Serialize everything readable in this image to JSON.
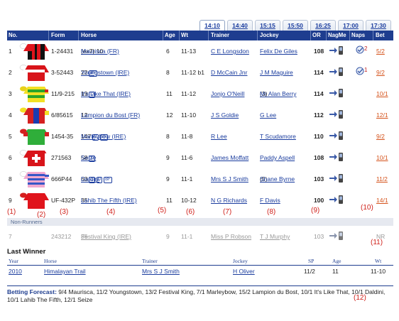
{
  "tabs": [
    "14:10",
    "14:40",
    "15:15",
    "15:50",
    "16:25",
    "17:00",
    "17:30"
  ],
  "active_tab": "14:10",
  "columns": {
    "no": "No.",
    "form": "Form",
    "horse": "Horse",
    "age": "Age",
    "wt": "Wt",
    "trainer": "Trainer",
    "jockey": "Jockey",
    "or": "OR",
    "nagme": "NagMe",
    "naps": "Naps",
    "bet": "Bet"
  },
  "runners": [
    {
      "no": "1",
      "form": "1-24431",
      "horse": "Maurisca (FR)",
      "horse_extra": "(ex7) 10",
      "badges": [],
      "age": "6",
      "wt": "11-13",
      "trainer": "C E Longsdon",
      "jockey": "Felix De Giles",
      "jockey_extra": "",
      "or": "108",
      "naps": "2",
      "bet": "5/2"
    },
    {
      "no": "2",
      "form": "3-52443",
      "horse": "Youngstown (IRE)",
      "horse_extra": "22",
      "badges": [
        "BF"
      ],
      "age": "8",
      "wt": "11-12 b1",
      "trainer": "D McCain Jnr",
      "jockey": "J M Maguire",
      "jockey_extra": "",
      "or": "114",
      "naps": "1",
      "bet": "9/2"
    },
    {
      "no": "3",
      "form": "11/9-215",
      "horse": "It's Like That (IRE)",
      "horse_extra": "19",
      "badges": [
        "D"
      ],
      "age": "11",
      "wt": "11-12",
      "trainer": "Jonjo O'Neill",
      "jockey": "Mr Alan Berry",
      "jockey_extra": "(3)",
      "or": "114",
      "naps": "",
      "bet": "10/1"
    },
    {
      "no": "4",
      "form": "6/85615",
      "horse": "Lampion du Bost (FR)",
      "horse_extra": "12",
      "badges": [],
      "age": "12",
      "wt": "11-10",
      "trainer": "J S Goldie",
      "jockey": "G Lee",
      "jockey_extra": "",
      "or": "112",
      "naps": "",
      "bet": "12/1"
    },
    {
      "no": "5",
      "form": "1454-35",
      "horse": "Marleybow (IRE)",
      "horse_extra": "147",
      "badges": [
        "C",
        "BF"
      ],
      "age": "8",
      "wt": "11-8",
      "trainer": "R Lee",
      "jockey": "T Scudamore",
      "jockey_extra": "",
      "or": "110",
      "naps": "",
      "bet": "9/2"
    },
    {
      "no": "6",
      "form": "271563",
      "horse": "Seize",
      "horse_extra": "58",
      "badges": [
        "D"
      ],
      "age": "9",
      "wt": "11-6",
      "trainer": "James Moffatt",
      "jockey": "Paddy Aspell",
      "jockey_extra": "",
      "or": "108",
      "naps": "",
      "bet": "10/1"
    },
    {
      "no": "8",
      "form": "666P44",
      "horse": "Daldini",
      "horse_extra": "63",
      "badges": [
        "C",
        "D",
        "BF"
      ],
      "age": "9",
      "wt": "11-1",
      "trainer": "Mrs S J Smith",
      "jockey": "Shane Byrne",
      "jockey_extra": "(5)",
      "or": "103",
      "naps": "",
      "bet": "11/2"
    },
    {
      "no": "9",
      "form": "UF-432P",
      "horse": "Lahib The Fifth (IRE)",
      "horse_extra": "35",
      "badges": [],
      "age": "11",
      "wt": "10-12",
      "trainer": "N G Richards",
      "jockey": "F Davis",
      "jockey_extra": "",
      "or": "100",
      "naps": "",
      "bet": "14/1"
    }
  ],
  "annotations": [
    "(1)",
    "(2)",
    "(3)",
    "(4)",
    "(5)",
    "(6)",
    "(7)",
    "(8)",
    "(9)",
    "(10)",
    "(11)",
    "(12)"
  ],
  "non_runners_label": "Non-Runners",
  "non_runner": {
    "no": "7",
    "form": "243212",
    "horse": "Festival King (IRE)",
    "horse_extra": "35",
    "age": "9",
    "wt": "11-1",
    "trainer": "Miss P Robson",
    "jockey": "T J Murphy",
    "or": "103",
    "bet": "NR"
  },
  "last_winner": {
    "title": "Last Winner",
    "headers": {
      "year": "Year",
      "horse": "Horse",
      "trainer": "Trainer",
      "jockey": "Jockey",
      "sp": "SP",
      "age": "Age",
      "wt": "Wt"
    },
    "year": "2010",
    "horse": "Himalayan Trail",
    "trainer": "Mrs S J Smith",
    "jockey": "H Oliver",
    "sp": "11/2",
    "age": "11",
    "wt": "11-10"
  },
  "forecast": {
    "label": "Betting Forecast:",
    "text": "9/4 Maurisca, 11/2 Youngstown, 13/2 Festival King, 7/1 Marleybow, 15/2 Lampion du Bost, 10/1 It's Like That, 10/1 Daldini, 10/1 Lahib The Fifth, 12/1 Seize"
  },
  "colors": {
    "header": "#1e3d8f",
    "link": "#1a3c9e",
    "bet": "#d5531c",
    "annotation": "#d0201a"
  },
  "icons": {
    "nagme": "mobile-phone-arrow-icon",
    "naps": "tick-badge-icon",
    "silks": "jockey-silks-icon"
  }
}
